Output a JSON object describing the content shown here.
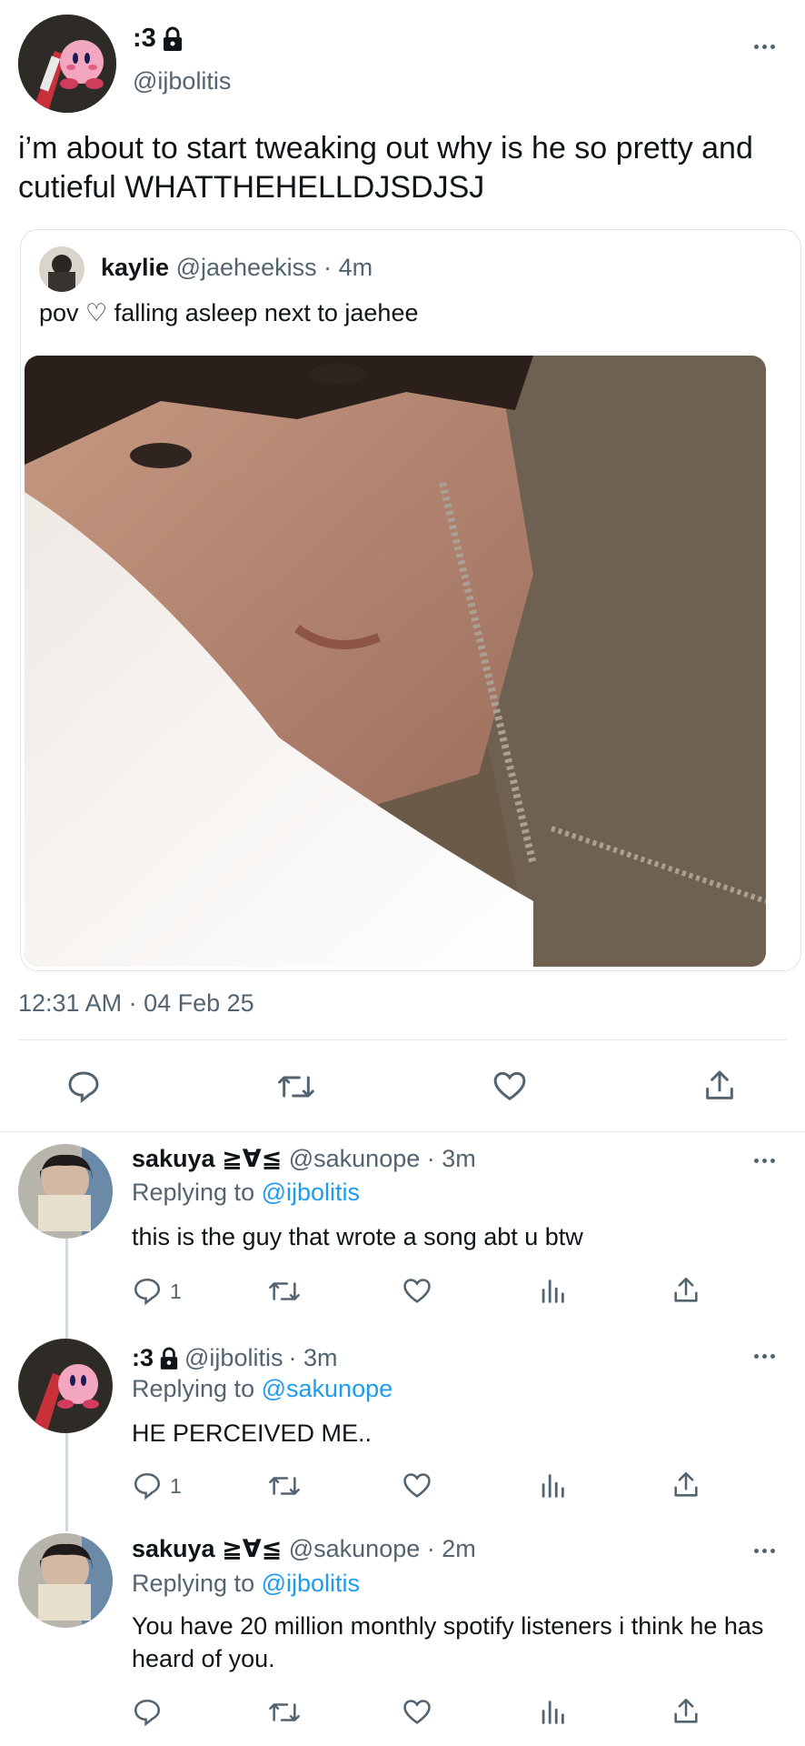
{
  "main_tweet": {
    "display_name": ":3",
    "handle": "@ijbolitis",
    "text": "i’m about to start tweaking out why is he so pretty and cutieful WHATTHEHELLDJSDJSJ",
    "timestamp": "12:31 AM · 04 Feb 25"
  },
  "quoted_tweet": {
    "display_name": "kaylie",
    "handle": "@jaeheekiss",
    "time": "· 4m",
    "text": "pov ♡ falling asleep next to jaehee"
  },
  "replies": [
    {
      "display_name": "sakuya ≧∀≦",
      "handle": "@sakunope",
      "time": "· 3m",
      "replying_label": "Replying to",
      "replying_to": "@ijbolitis",
      "text": "this is the guy that wrote a song abt u btw",
      "reply_count": "1"
    },
    {
      "display_name": ":3",
      "handle": "@ijbolitis",
      "time": "· 3m",
      "replying_label": "Replying to",
      "replying_to": "@sakunope",
      "text": "HE PERCEIVED ME..",
      "reply_count": "1"
    },
    {
      "display_name": "sakuya ≧∀≦",
      "handle": "@sakunope",
      "time": "· 2m",
      "replying_label": "Replying to",
      "replying_to": "@ijbolitis",
      "text": "You have 20 million monthly spotify listeners i think he has heard of you.",
      "reply_count": ""
    }
  ],
  "colors": {
    "accent": "#1d9bf0",
    "muted": "#536471",
    "divider": "#e6e9ec"
  }
}
